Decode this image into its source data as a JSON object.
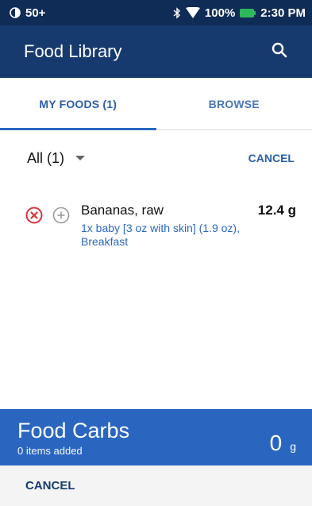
{
  "status_bar": {
    "battery_level": "50+",
    "battery_percent": "100%",
    "time": "2:30 PM",
    "icons": [
      "pump-battery-icon",
      "bluetooth-icon",
      "wifi-icon",
      "battery-charging-icon"
    ]
  },
  "header": {
    "title": "Food Library",
    "icon": "search-icon"
  },
  "tabs": [
    {
      "label": "MY FOODS (1)",
      "active": true
    },
    {
      "label": "BROWSE",
      "active": false
    }
  ],
  "filter": {
    "selected": "All (1)",
    "cancel_label": "CANCEL"
  },
  "food_items": [
    {
      "name": "Bananas, raw",
      "detail": "1x baby [3 oz with skin] (1.9 oz), Breakfast",
      "carbs": "12.4 g"
    }
  ],
  "summary": {
    "title": "Food Carbs",
    "subtitle": "0 items added",
    "value": "0",
    "unit": "g"
  },
  "footer": {
    "cancel_label": "CANCEL"
  },
  "colors": {
    "status_bar": "#0f2c57",
    "header": "#173a6e",
    "accent": "#2a67c4",
    "summary": "#2a66c0",
    "remove_red": "#d9343a"
  }
}
